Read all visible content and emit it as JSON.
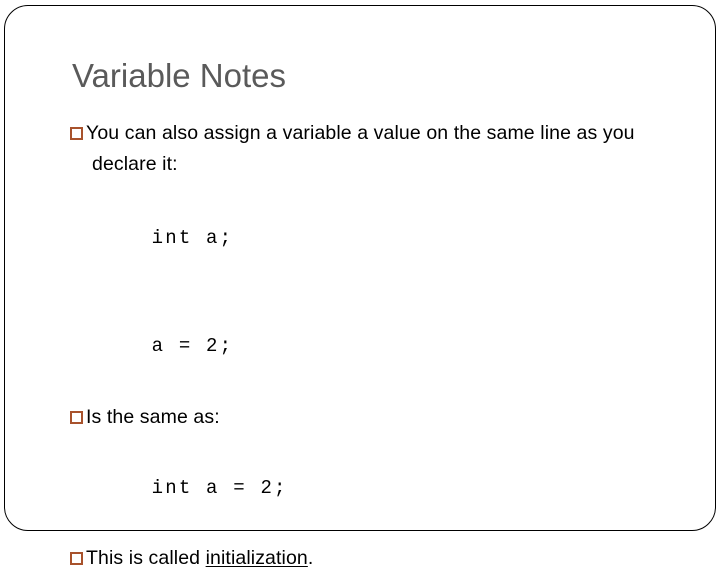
{
  "slide": {
    "title": "Variable Notes",
    "title_color": "#5a5a5a",
    "background_color": "#ffffff",
    "frame_border_color": "#000000",
    "bullet_color": "#a8522c",
    "bullet_glyph": "hollow-square",
    "body": {
      "lines": [
        {
          "kind": "bullet",
          "text": "You can also assign a variable a value on the same line as you declare it:"
        },
        {
          "kind": "code",
          "text": "int a;"
        },
        {
          "kind": "code",
          "text": "a = 2;"
        },
        {
          "kind": "bullet",
          "text": "Is the same as:"
        },
        {
          "kind": "code",
          "text": "int a = 2;"
        },
        {
          "kind": "bullet",
          "text_before": "This is called ",
          "text_underlined": "initialization",
          "text_after": "."
        }
      ]
    }
  }
}
